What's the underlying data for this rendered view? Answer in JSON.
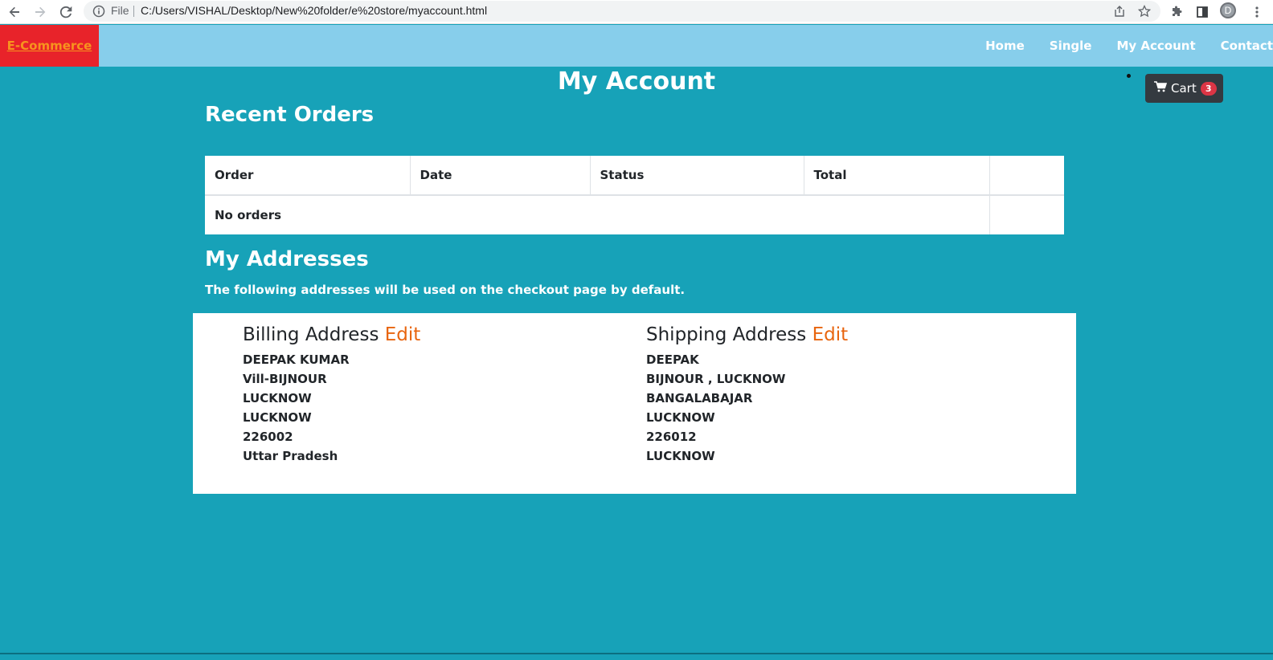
{
  "browser": {
    "file_label": "File",
    "url": "C:/Users/VISHAL/Desktop/New%20folder/e%20store/myaccount.html",
    "profile_initial": "D"
  },
  "navbar": {
    "brand": "E-Commerce",
    "links": [
      "Home",
      "Single",
      "My Account",
      "Contact"
    ]
  },
  "cart": {
    "label": "Cart",
    "count": "3"
  },
  "page": {
    "title": "My Account"
  },
  "orders": {
    "heading": "Recent Orders",
    "columns": [
      "Order",
      "Date",
      "Status",
      "Total"
    ],
    "empty_text": "No orders"
  },
  "addresses": {
    "heading": "My Addresses",
    "note": "The following addresses will be used on the checkout page by default.",
    "billing": {
      "title": "Billing Address",
      "edit_label": "Edit",
      "lines": [
        "DEEPAK KUMAR",
        "Vill-BIJNOUR",
        "LUCKNOW",
        "LUCKNOW",
        "226002",
        "Uttar Pradesh"
      ]
    },
    "shipping": {
      "title": "Shipping Address",
      "edit_label": "Edit",
      "lines": [
        "DEEPAK",
        "BIJNOUR , LUCKNOW",
        "BANGALABAJAR",
        "LUCKNOW",
        "226012",
        "LUCKNOW"
      ]
    }
  },
  "colors": {
    "page_bg": "#17a2b8",
    "navbar_bg": "#87ceeb",
    "brand_bg": "#e8232a",
    "brand_text": "#f7931e",
    "edit_link": "#e8650f",
    "cart_bg": "#343a40",
    "badge_bg": "#dc3545"
  }
}
